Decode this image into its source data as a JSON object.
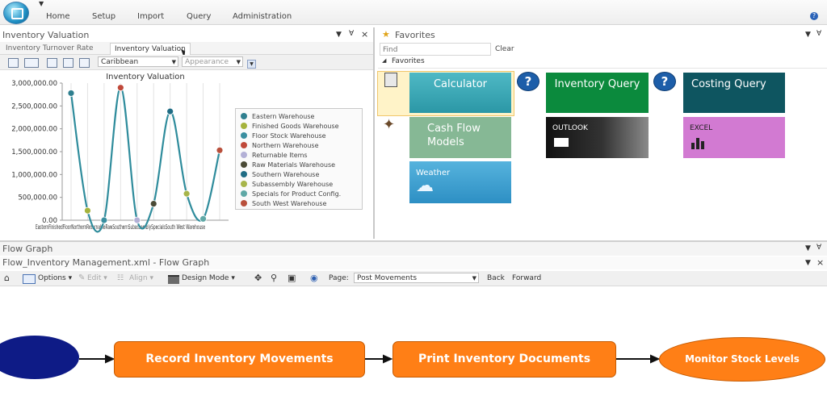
{
  "menu": {
    "items": [
      "Home",
      "Setup",
      "Import",
      "Query",
      "Administration"
    ]
  },
  "left_panel": {
    "title": "Inventory Valuation",
    "tabs": [
      "Inventory Turnover Rate",
      "Inventory Valuation"
    ],
    "toolbar": {
      "theme": "Caribbean",
      "appearance": "Appearance"
    }
  },
  "chart_data": {
    "type": "line",
    "title": "Inventory Valuation",
    "xlabel": "",
    "ylabel": "",
    "ylim": [
      0,
      3000000
    ],
    "y_ticks": [
      "0.00",
      "500,000.00",
      "1,000,000.00",
      "1,500,000.00",
      "2,000,000.00",
      "2,500,000.00",
      "3,000,000.00"
    ],
    "x_tick_text": "EasternFinishedFloorNorthernReturnableRawSouthernSubassemblySpecialsSouth West Warehouse",
    "categories": [
      "Eastern Warehouse",
      "Finished Goods Warehouse",
      "Floor Stock Warehouse",
      "Northern Warehouse",
      "Returnable Items",
      "Raw Materials Warehouse",
      "Southern Warehouse",
      "Subassembly Warehouse",
      "Specials for Product Config.",
      "South West Warehouse"
    ],
    "values": [
      2780000,
      210000,
      0,
      2900000,
      0,
      360000,
      2380000,
      580000,
      30000,
      1530000
    ],
    "colors": [
      "#2f7f8f",
      "#a5b33c",
      "#3a8fa0",
      "#c0493a",
      "#b3b0d6",
      "#4a4a36",
      "#1f6c84",
      "#a7b54a",
      "#5fa8a6",
      "#b9503c"
    ],
    "legend": [
      "Eastern Warehouse",
      "Finished Goods Warehouse",
      "Floor Stock Warehouse",
      "Northern Warehouse",
      "Returnable Items",
      "Raw Materials Warehouse",
      "Southern Warehouse",
      "Subassembly Warehouse",
      "Specials for Product Config.",
      "South West Warehouse"
    ],
    "legend_position": "right",
    "grid": true
  },
  "favorites": {
    "title": "Favorites",
    "find_placeholder": "Find",
    "clear_label": "Clear",
    "section": "Favorites",
    "tiles": {
      "calculator": "Calculator",
      "cash_flow": "Cash Flow Models",
      "weather": "Weather",
      "inventory_query": "Inventory Query",
      "outlook": "OUTLOOK",
      "costing_query": "Costing Query",
      "excel": "EXCEL"
    },
    "help_glyph": "?"
  },
  "flow": {
    "panel_title": "Flow Graph",
    "doc_title": "Flow_Inventory Management.xml - Flow Graph",
    "toolbar": {
      "options": "Options",
      "edit": "Edit",
      "align": "Align",
      "design_mode": "Design Mode",
      "page_label": "Page:",
      "page_value": "Post Movements",
      "back": "Back",
      "forward": "Forward"
    },
    "nodes": [
      "Record Inventory Movements",
      "Print Inventory Documents",
      "Monitor Stock Levels"
    ]
  },
  "colors": {
    "flow_node": "#ff7f16",
    "start_node": "#0e1b86",
    "tile_calculator": "#2fa4b4",
    "tile_cashflow": "#7fb38f",
    "tile_weather": "#3b9fd3",
    "tile_inventory": "#0b8a3d",
    "tile_outlook": "#222222",
    "tile_costing": "#0e5560",
    "tile_excel": "#d27ad2"
  }
}
